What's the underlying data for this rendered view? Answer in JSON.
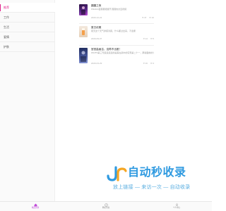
{
  "sidebar": {
    "items": [
      {
        "label": "推荐",
        "active": true
      },
      {
        "label": "工作",
        "active": false
      },
      {
        "label": "生活",
        "active": false
      },
      {
        "label": "爱情",
        "active": false
      },
      {
        "label": "护肤",
        "active": false
      }
    ]
  },
  "posts": [
    {
      "title": "圆圆之夜",
      "excerpt": "PRADA夜幕都能展开 圆圆的文显视频",
      "date": "2020-12-22",
      "likes": "47",
      "comments": "10",
      "thumb_colors": [
        "#3a1a5c",
        "#c04bd8"
      ]
    },
    {
      "title": "夏日优雅",
      "excerpt": "夏天这个天气穿搭清爽，什么都过出来，不会累",
      "date": "2020-09-07",
      "likes": "14",
      "comments": "5",
      "thumb_colors": [
        "#e8d4c0",
        "#f5a04a"
      ]
    },
    {
      "title": "宫宫盐画吉，没再不出差！",
      "excerpt": "WAITS第三刊遥遥遥遥的是美在某中的实现第二十一，那些面前的计划",
      "date": "2020-03-29",
      "likes": "16",
      "comments": "3",
      "thumb_colors": [
        "#1e2a5a",
        "#8a9ad8"
      ]
    }
  ],
  "watermark": {
    "title": "自动秒收录",
    "subtitle": "放上链接 — 来访一次 — 自动收录"
  },
  "tabbar": {
    "tabs": [
      {
        "label": "精选文章",
        "icon": "home-icon",
        "active": true
      },
      {
        "label": "网址导航",
        "icon": "compass-icon",
        "active": false
      },
      {
        "label": "个人中心",
        "icon": "user-icon",
        "active": false
      }
    ]
  },
  "colors": {
    "accent": "#e0218a",
    "tab_active": "#c04bd8",
    "watermark_blue": "#2f9ae0"
  }
}
